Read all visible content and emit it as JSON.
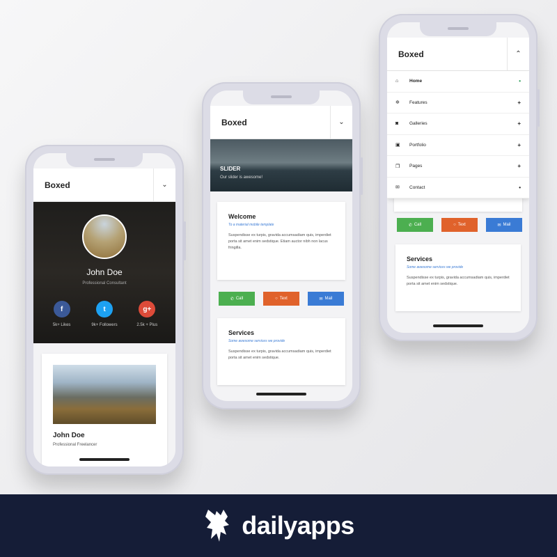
{
  "phone1": {
    "app_title": "Boxed",
    "profile": {
      "name": "John Doe",
      "role": "Professional Consultant"
    },
    "socials": [
      {
        "icon": "facebook-icon",
        "glyph": "f",
        "color": "#3b5998",
        "label": "5k+ Likes"
      },
      {
        "icon": "twitter-icon",
        "glyph": "t",
        "color": "#1da1f2",
        "label": "9k+ Followers"
      },
      {
        "icon": "google-plus-icon",
        "glyph": "g+",
        "color": "#dd4b39",
        "label": "2.5k + Plus"
      }
    ],
    "card": {
      "name": "John Doe",
      "subtitle": "Professional Freelancer"
    }
  },
  "phone2": {
    "app_title": "Boxed",
    "slider": {
      "title": "SLIDER",
      "subtitle": "Our slider is awesome!"
    },
    "welcome": {
      "title": "Welcome",
      "subtitle": "To a material mobile template",
      "text": "Suspendisse ex turpis, gravida accumsadiam quis, imperdiet porta sit amet enim sedstique. Etiam auctor nibh non lacus fringilla."
    },
    "buttons": [
      {
        "label": "Call",
        "icon": "phone-icon",
        "glyph": "✆",
        "color": "#4caf50"
      },
      {
        "label": "Text",
        "icon": "chat-icon",
        "glyph": "○",
        "color": "#e0622b"
      },
      {
        "label": "Mail",
        "icon": "mail-icon",
        "glyph": "✉",
        "color": "#3a7bd5"
      }
    ],
    "services": {
      "title": "Services",
      "subtitle": "Some awesome services we provide",
      "text": "Suspendisse ex turpis, gravida accumsadiam quis, imperdiet porta sit amet enim sedstique."
    }
  },
  "phone3": {
    "app_title": "Boxed",
    "menu": [
      {
        "label": "Home",
        "icon": "home-icon",
        "glyph": "⌂",
        "mark": "•",
        "mark_color": "#2e9e5b"
      },
      {
        "label": "Features",
        "icon": "gear-icon",
        "glyph": "✲",
        "mark": "+",
        "mark_color": "#222222"
      },
      {
        "label": "Galleries",
        "icon": "camera-icon",
        "glyph": "◙",
        "mark": "+",
        "mark_color": "#222222"
      },
      {
        "label": "Portfolio",
        "icon": "image-icon",
        "glyph": "▣",
        "mark": "+",
        "mark_color": "#222222"
      },
      {
        "label": "Pages",
        "icon": "pages-icon",
        "glyph": "❐",
        "mark": "+",
        "mark_color": "#222222"
      },
      {
        "label": "Contact",
        "icon": "envelope-icon",
        "glyph": "✉",
        "mark": "•",
        "mark_color": "#222222"
      }
    ],
    "buttons": [
      {
        "label": "Call",
        "icon": "phone-icon",
        "glyph": "✆",
        "color": "#4caf50"
      },
      {
        "label": "Text",
        "icon": "chat-icon",
        "glyph": "○",
        "color": "#e0622b"
      },
      {
        "label": "Mail",
        "icon": "mail-icon",
        "glyph": "✉",
        "color": "#3a7bd5"
      }
    ],
    "services": {
      "title": "Services",
      "subtitle": "Some awesome services we provide",
      "text": "Suspendisse ex turpis, gravida accumsadiam quis, imperdiet porta sit amet enim sedstique."
    }
  },
  "banner": {
    "brand": "dailyapps",
    "logo_icon": "dailyapps-logo-icon"
  }
}
